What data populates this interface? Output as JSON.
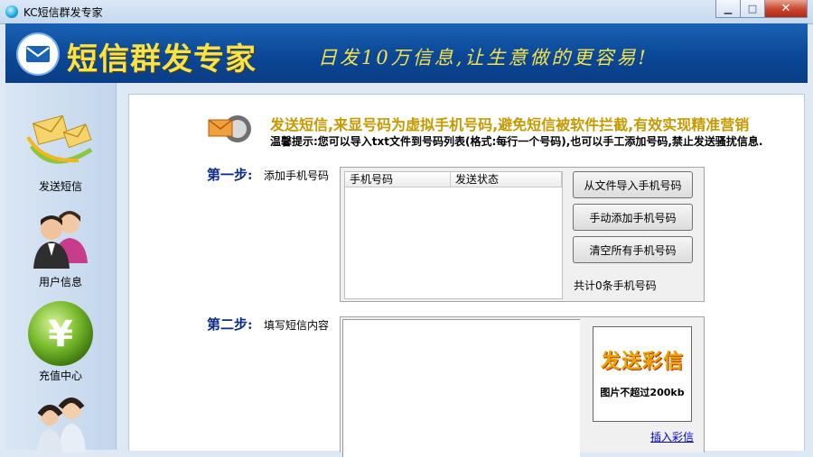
{
  "window": {
    "title": "KC短信群发专家"
  },
  "header": {
    "brand": "短信群发专家",
    "slogan": "日发10万信息,让生意做的更容易!"
  },
  "sidebar": {
    "items": [
      {
        "label": "发送短信",
        "icon": "sms-envelopes-icon"
      },
      {
        "label": "用户信息",
        "icon": "users-icon"
      },
      {
        "label": "充值中心",
        "icon": "yen-icon"
      },
      {
        "label": "",
        "icon": "customer-service-icon"
      }
    ]
  },
  "banner": {
    "title": "发送短信,来显号码为虚拟手机号码,避免短信被软件拦截,有效实现精准营销",
    "tip": "温馨提示:您可以导入txt文件到号码列表(格式:每行一个号码),也可以手工添加号码,禁止发送骚扰信息."
  },
  "step1": {
    "title": "第一步:",
    "desc": "添加手机号码",
    "columns": [
      "手机号码",
      "发送状态"
    ],
    "buttons": {
      "import": "从文件导入手机号码",
      "add": "手动添加手机号码",
      "clear": "清空所有手机号码"
    },
    "count_text": "共计0条手机号码"
  },
  "step2": {
    "title": "第二步:",
    "desc": "填写短信内容",
    "mms_title": "发送彩信",
    "mms_sub": "图片不超过200kb",
    "insert_link": "插入彩信"
  },
  "colors": {
    "header": "#0b4796",
    "brand_yellow": "#f6e24a",
    "step_blue": "#0a2a8c",
    "link": "#0000cc"
  }
}
